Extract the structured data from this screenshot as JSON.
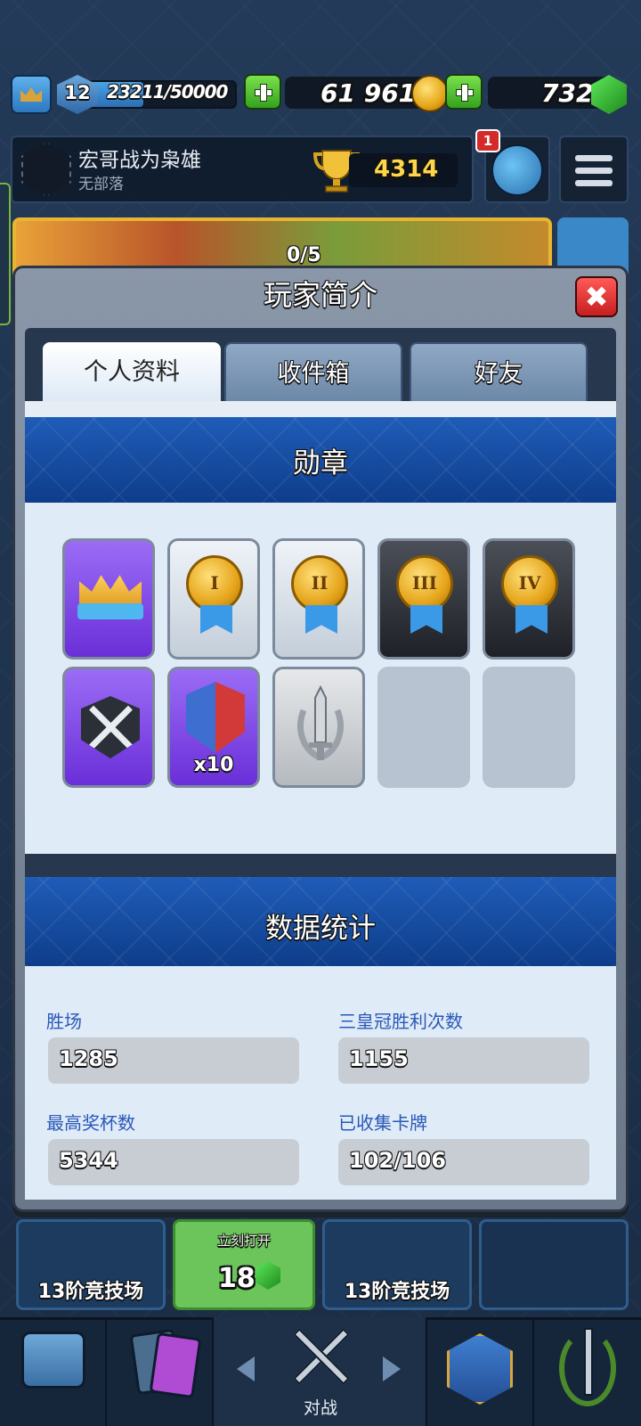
{
  "topbar": {
    "level": "12",
    "xp_text": "23211/50000",
    "xp_progress": 0.464,
    "gold": "61 961",
    "gems": "732"
  },
  "player": {
    "name": "宏哥战为枭雄",
    "clan": "无部落",
    "trophies": "4314",
    "notification_count": "1"
  },
  "background": {
    "banner_progress": "0/5",
    "chest_left_label": "13阶竞技场",
    "chest_middle_label": "立刻打开",
    "chest_middle_cost": "18",
    "chest_right_label": "13阶竞技场",
    "nav_battle_label": "对战"
  },
  "modal": {
    "title": "玩家简介",
    "close_label": "✖",
    "tabs": [
      {
        "label": "个人资料",
        "active": true
      },
      {
        "label": "收件箱",
        "active": false
      },
      {
        "label": "好友",
        "active": false
      }
    ],
    "badges_title": "勋章",
    "badges": [
      {
        "icon": "crown-badge-icon",
        "style": "purple"
      },
      {
        "icon": "medal-i-icon",
        "medal": "I",
        "style": "silver"
      },
      {
        "icon": "medal-ii-icon",
        "medal": "II",
        "style": "silver"
      },
      {
        "icon": "medal-iii-icon",
        "medal": "III",
        "style": "dark"
      },
      {
        "icon": "medal-iv-icon",
        "medal": "IV",
        "style": "dark"
      },
      {
        "icon": "crossed-swords-badge-icon",
        "style": "purple"
      },
      {
        "icon": "red-blue-shield-badge-icon",
        "count": "x10",
        "style": "purple"
      },
      {
        "icon": "sword-laurel-badge-icon",
        "style": "grey"
      },
      {
        "icon": "empty-slot",
        "style": "empty"
      },
      {
        "icon": "empty-slot",
        "style": "empty"
      }
    ],
    "stats_title": "数据统计",
    "stats": {
      "wins_label": "胜场",
      "wins_value": "1285",
      "three_crown_label": "三皇冠胜利次数",
      "three_crown_value": "1155",
      "best_trophies_label": "最高奖杯数",
      "best_trophies_value": "5344",
      "cards_label": "已收集卡牌",
      "cards_value": "102/106"
    }
  },
  "colors": {
    "accent_blue": "#1f5cb8",
    "stat_label_blue": "#2a59b8",
    "close_red": "#d42a2a",
    "plus_green": "#34a21f",
    "gold": "#e6a417"
  }
}
